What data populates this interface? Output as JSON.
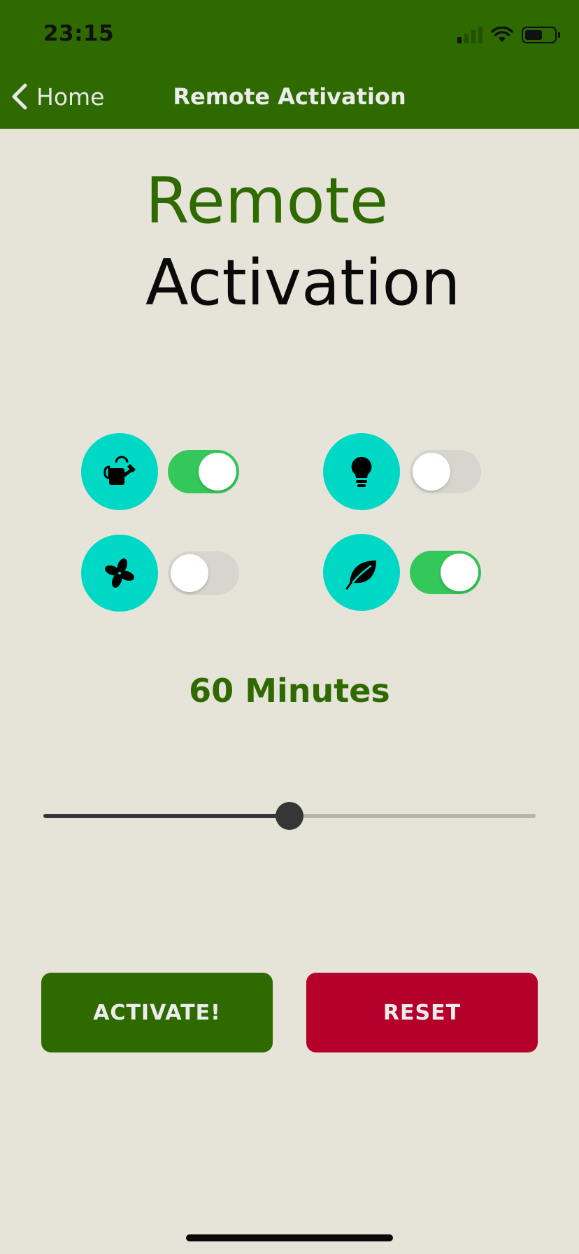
{
  "status_bar": {
    "time": "23:15",
    "icons": [
      "cellular-signal-icon",
      "wifi-icon",
      "battery-icon"
    ],
    "battery_level": 0.6
  },
  "nav": {
    "back_label": "Home",
    "title": "Remote Activation"
  },
  "hero": {
    "line1": "Remote",
    "line2": "Activation"
  },
  "devices": [
    {
      "icon": "watering-can-icon",
      "on": true
    },
    {
      "icon": "lightbulb-icon",
      "on": false
    },
    {
      "icon": "fan-icon",
      "on": false
    },
    {
      "icon": "leaf-icon",
      "on": true
    }
  ],
  "duration": {
    "label": "60 Minutes",
    "slider_fraction": 0.5
  },
  "buttons": {
    "activate": "ACTIVATE!",
    "reset": "RESET"
  },
  "colors": {
    "brand_green": "#2e6a00",
    "teal": "#00d8c6",
    "toggle_on": "#34c759",
    "reset_red": "#b4002a",
    "background": "#e6e4d9"
  }
}
